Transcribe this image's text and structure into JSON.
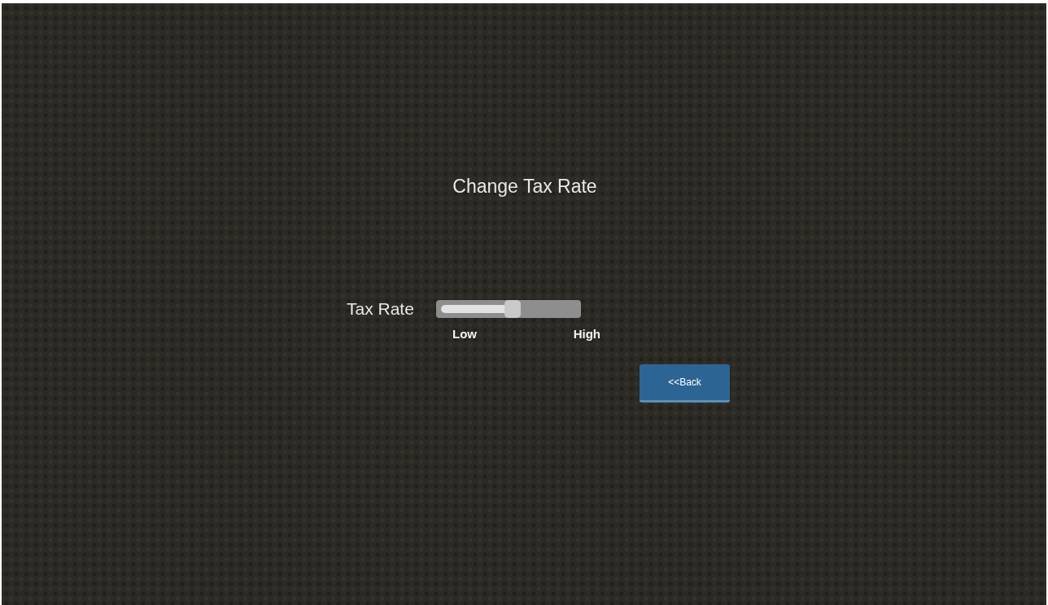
{
  "title": "Change Tax Rate",
  "slider": {
    "label": "Tax Rate",
    "level": 0.53,
    "min_label": "Low",
    "max_label": "High"
  },
  "buttons": [
    {
      "label": "<<Back"
    }
  ]
}
